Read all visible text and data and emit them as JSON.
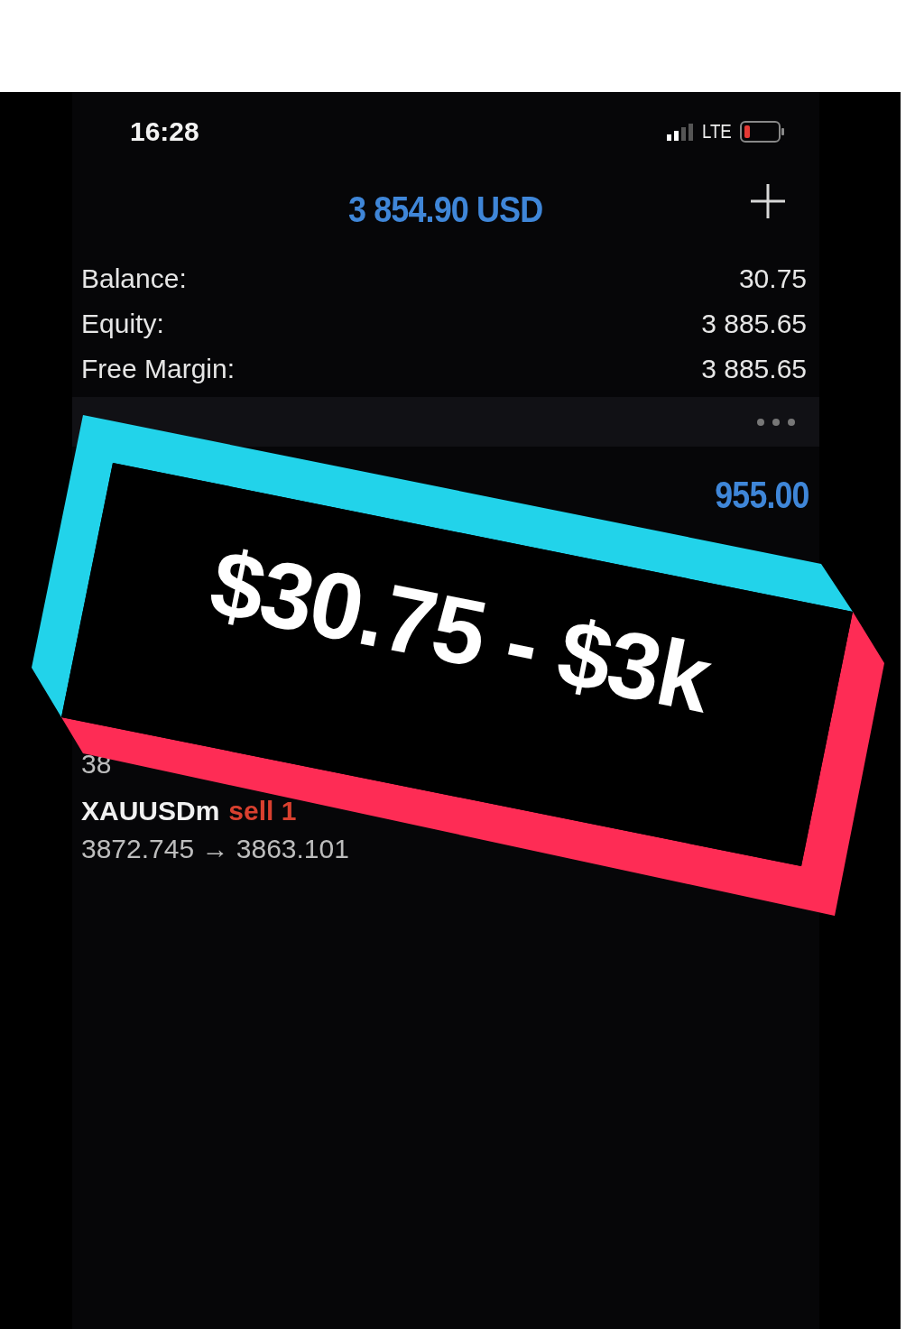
{
  "status_bar": {
    "time": "16:28",
    "network": "LTE"
  },
  "header": {
    "total": "3 854.90 USD"
  },
  "summary": [
    {
      "label": "Balance:",
      "value": "30.75"
    },
    {
      "label": "Equity:",
      "value": "3 885.65"
    },
    {
      "label": "Free Margin:",
      "value": "3 885.65"
    }
  ],
  "profit": "955.00",
  "positions": [
    {
      "prices": "38"
    },
    {
      "symbol": "XAUUSDm",
      "side": "sell 1",
      "prices": "3872.745 → 3863.101"
    }
  ],
  "overlay": {
    "text": "$30.75 - $3k"
  }
}
